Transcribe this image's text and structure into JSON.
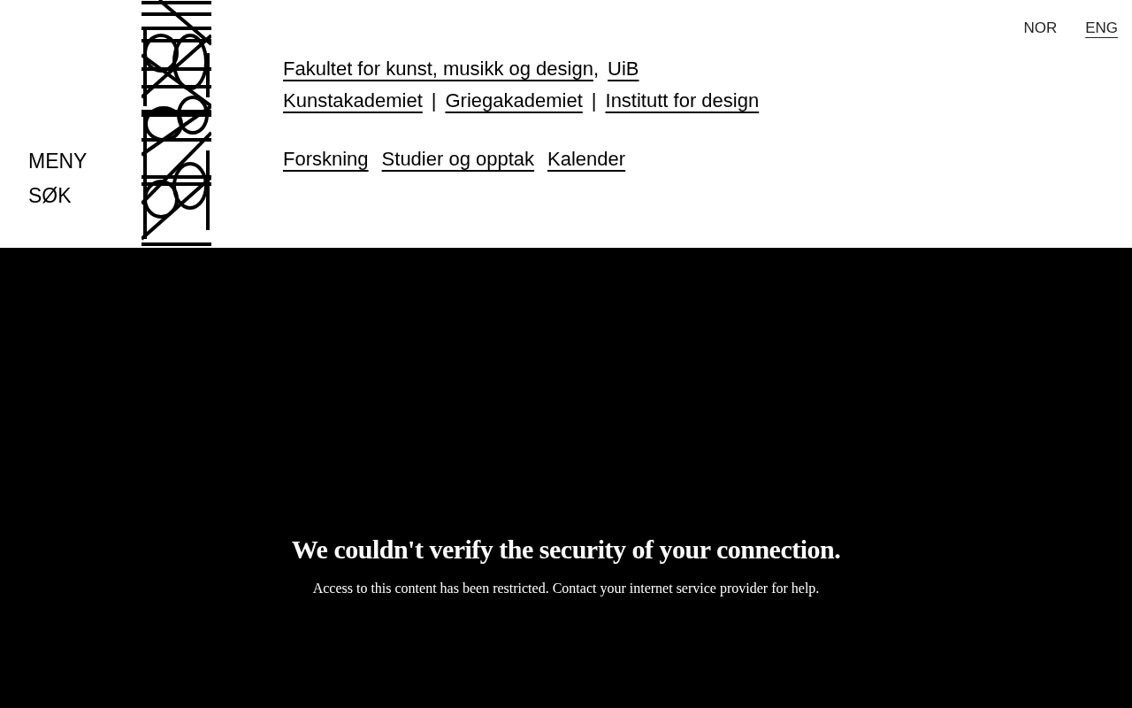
{
  "language": [
    {
      "label": "NOR",
      "selected": false
    },
    {
      "label": "ENG",
      "selected": true
    }
  ],
  "side_menu": [
    "MENY",
    "SØK"
  ],
  "links_rows": [
    [
      {
        "kind": "link",
        "text": "Fakultet for kunst, musikk og design"
      },
      {
        "kind": "separator",
        "text": ","
      },
      {
        "kind": "link",
        "text": "UiB"
      }
    ],
    [
      {
        "kind": "link",
        "text": "Kunstakademiet"
      },
      {
        "kind": "separator",
        "text": "|"
      },
      {
        "kind": "link",
        "text": "Griegakademiet"
      },
      {
        "kind": "separator",
        "text": "|"
      },
      {
        "kind": "link",
        "text": "Institutt for design"
      }
    ],
    [
      {
        "kind": "link",
        "text": "Forskning"
      },
      {
        "kind": "link",
        "text": "Studier og opptak"
      },
      {
        "kind": "link",
        "text": "Kalender"
      }
    ]
  ],
  "notice": {
    "title": "We couldn't verify the security of your connection.",
    "message": "Access to this content has been restricted. Contact your internet service provider for help."
  }
}
